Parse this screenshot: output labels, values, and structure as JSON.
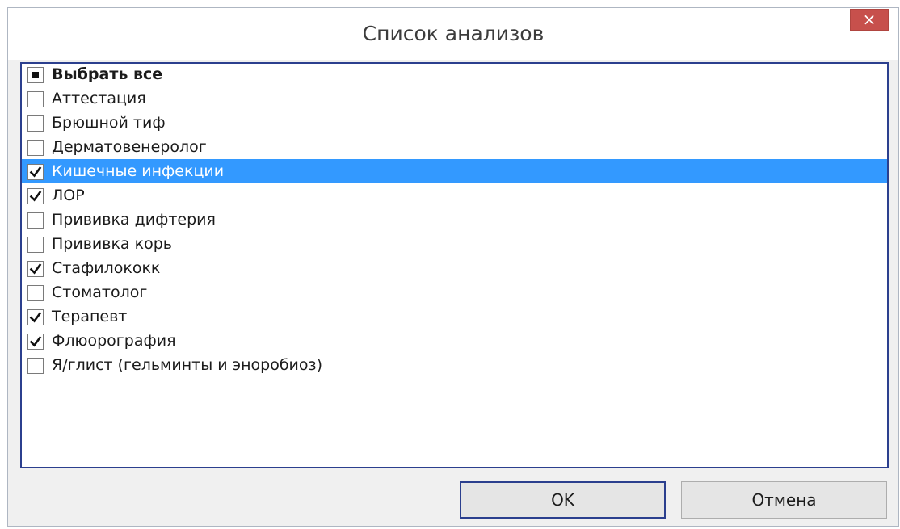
{
  "dialog": {
    "title": "Список анализов",
    "close_label": "×"
  },
  "list": {
    "items": [
      {
        "label": "Выбрать все",
        "state": "indeterminate",
        "bold": true,
        "selected": false
      },
      {
        "label": "Аттестация",
        "state": "unchecked",
        "bold": false,
        "selected": false
      },
      {
        "label": "Брюшной тиф",
        "state": "unchecked",
        "bold": false,
        "selected": false
      },
      {
        "label": "Дерматовенеролог",
        "state": "unchecked",
        "bold": false,
        "selected": false
      },
      {
        "label": "Кишечные инфекции",
        "state": "checked",
        "bold": false,
        "selected": true
      },
      {
        "label": "ЛОР",
        "state": "checked",
        "bold": false,
        "selected": false
      },
      {
        "label": "Прививка дифтерия",
        "state": "unchecked",
        "bold": false,
        "selected": false
      },
      {
        "label": "Прививка корь",
        "state": "unchecked",
        "bold": false,
        "selected": false
      },
      {
        "label": "Стафилококк",
        "state": "checked",
        "bold": false,
        "selected": false
      },
      {
        "label": "Стоматолог",
        "state": "unchecked",
        "bold": false,
        "selected": false
      },
      {
        "label": "Терапевт",
        "state": "checked",
        "bold": false,
        "selected": false
      },
      {
        "label": "Флюорография",
        "state": "checked",
        "bold": false,
        "selected": false
      },
      {
        "label": "Я/глист (гельминты и эноробиоз)",
        "state": "unchecked",
        "bold": false,
        "selected": false
      }
    ]
  },
  "buttons": {
    "ok_label": "OK",
    "cancel_label": "Отмена"
  },
  "colors": {
    "selection": "#3399ff",
    "close": "#c7504c",
    "focus_border": "#2b3f8e"
  }
}
